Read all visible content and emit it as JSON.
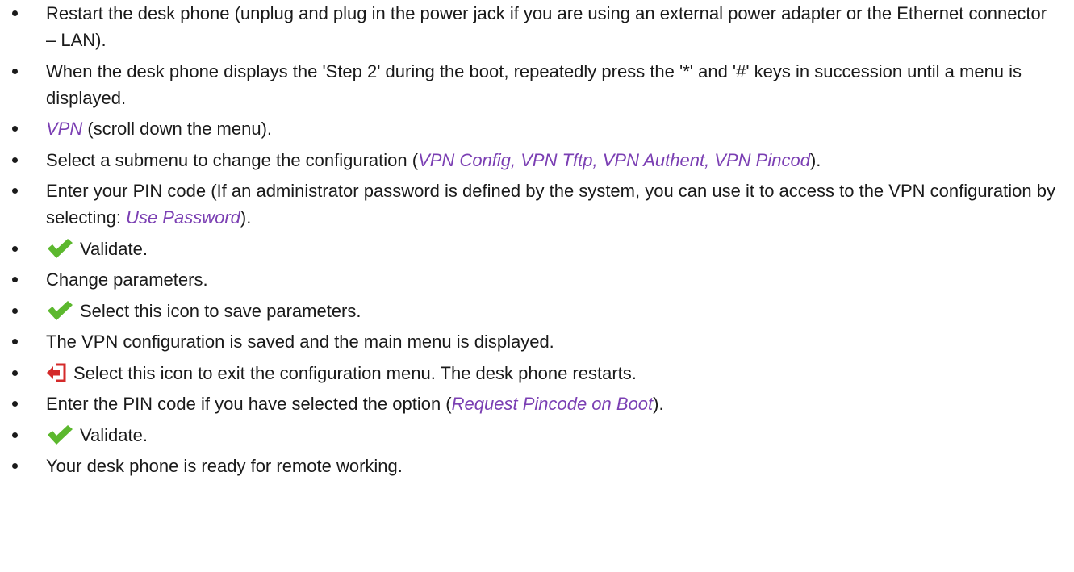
{
  "colors": {
    "text": "#1a1a1a",
    "highlight": "#7b3fb3",
    "check_icon": "#5cb82e",
    "exit_icon": "#d42a2a"
  },
  "steps": [
    {
      "a": "Restart the desk phone (unplug and plug in the power jack if you are using an external power adapter or the Ethernet connector – LAN)."
    },
    {
      "a": "When the desk phone displays the 'Step 2' during the boot, repeatedly press the '*' and '#' keys in succession until a menu is displayed."
    },
    {
      "hl": "VPN",
      "b": " (scroll down the menu)."
    },
    {
      "a": "Select a submenu to change the configuration (",
      "hl": "VPN Config, VPN Tftp, VPN Authent, VPN Pincod",
      "b": ")."
    },
    {
      "a": "Enter your PIN code (If an administrator password is defined by the system, you can use it to access to the VPN configuration by selecting: ",
      "hl": "Use Password",
      "b": ")."
    },
    {
      "icon": "checkmark-icon",
      "a": "Validate."
    },
    {
      "a": "Change parameters."
    },
    {
      "icon": "checkmark-icon",
      "a": "Select this icon to save parameters."
    },
    {
      "a": "The VPN configuration is saved and the main menu is displayed."
    },
    {
      "icon": "exit-icon",
      "a": "Select this icon to exit the configuration menu. The desk phone restarts."
    },
    {
      "a": "Enter the PIN code if you have selected the option (",
      "hl": "Request Pincode on Boot",
      "b": ")."
    },
    {
      "icon": "checkmark-icon",
      "a": "Validate."
    },
    {
      "a": "Your desk phone is ready for remote working."
    }
  ]
}
